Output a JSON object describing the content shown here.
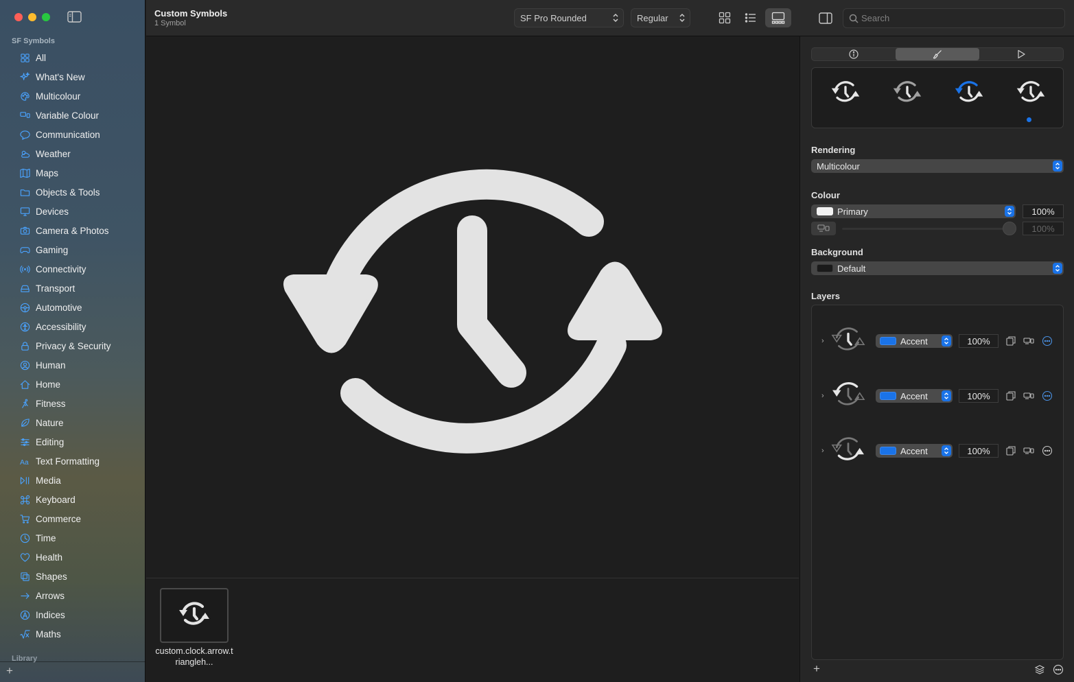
{
  "window": {
    "title": "Custom Symbols",
    "subtitle": "1 Symbol"
  },
  "toolbar": {
    "font_select": "SF Pro Rounded",
    "weight_select": "Regular",
    "search_placeholder": "Search"
  },
  "sidebar": {
    "section_title": "SF Symbols",
    "library_title": "Library",
    "items": [
      {
        "label": "All",
        "icon": "grid-icon"
      },
      {
        "label": "What's New",
        "icon": "sparkles-icon"
      },
      {
        "label": "Multicolour",
        "icon": "palette-icon"
      },
      {
        "label": "Variable Colour",
        "icon": "variable-colour-icon"
      },
      {
        "label": "Communication",
        "icon": "message-bubble-icon"
      },
      {
        "label": "Weather",
        "icon": "cloud-sun-icon"
      },
      {
        "label": "Maps",
        "icon": "map-icon"
      },
      {
        "label": "Objects & Tools",
        "icon": "folder-icon"
      },
      {
        "label": "Devices",
        "icon": "display-icon"
      },
      {
        "label": "Camera & Photos",
        "icon": "camera-icon"
      },
      {
        "label": "Gaming",
        "icon": "gamecontroller-icon"
      },
      {
        "label": "Connectivity",
        "icon": "antenna-icon"
      },
      {
        "label": "Transport",
        "icon": "car-icon"
      },
      {
        "label": "Automotive",
        "icon": "steering-wheel-icon"
      },
      {
        "label": "Accessibility",
        "icon": "accessibility-icon"
      },
      {
        "label": "Privacy & Security",
        "icon": "lock-icon"
      },
      {
        "label": "Human",
        "icon": "person-icon"
      },
      {
        "label": "Home",
        "icon": "house-icon"
      },
      {
        "label": "Fitness",
        "icon": "figure-run-icon"
      },
      {
        "label": "Nature",
        "icon": "leaf-icon"
      },
      {
        "label": "Editing",
        "icon": "sliders-icon"
      },
      {
        "label": "Text Formatting",
        "icon": "text-format-icon"
      },
      {
        "label": "Media",
        "icon": "play-pause-icon"
      },
      {
        "label": "Keyboard",
        "icon": "command-icon"
      },
      {
        "label": "Commerce",
        "icon": "cart-icon"
      },
      {
        "label": "Time",
        "icon": "clock-icon"
      },
      {
        "label": "Health",
        "icon": "heart-icon"
      },
      {
        "label": "Shapes",
        "icon": "shapes-icon"
      },
      {
        "label": "Arrows",
        "icon": "arrow-right-icon"
      },
      {
        "label": "Indices",
        "icon": "circle-a-icon"
      },
      {
        "label": "Maths",
        "icon": "sqrt-icon"
      }
    ]
  },
  "gallery": {
    "item_label": "custom.clock.arrow.triangleh..."
  },
  "inspector": {
    "rendering_label": "Rendering",
    "rendering_value": "Multicolour",
    "colour_label": "Colour",
    "colour_value": "Primary",
    "colour_opacity": "100%",
    "colour_secondary_opacity": "100%",
    "background_label": "Background",
    "background_value": "Default",
    "layers_label": "Layers",
    "layers": [
      {
        "colour": "Accent",
        "opacity": "100%"
      },
      {
        "colour": "Accent",
        "opacity": "100%"
      },
      {
        "colour": "Accent",
        "opacity": "100%"
      }
    ]
  },
  "colors": {
    "accent": "#1a73e8",
    "symbol": "#e3e3e3"
  }
}
